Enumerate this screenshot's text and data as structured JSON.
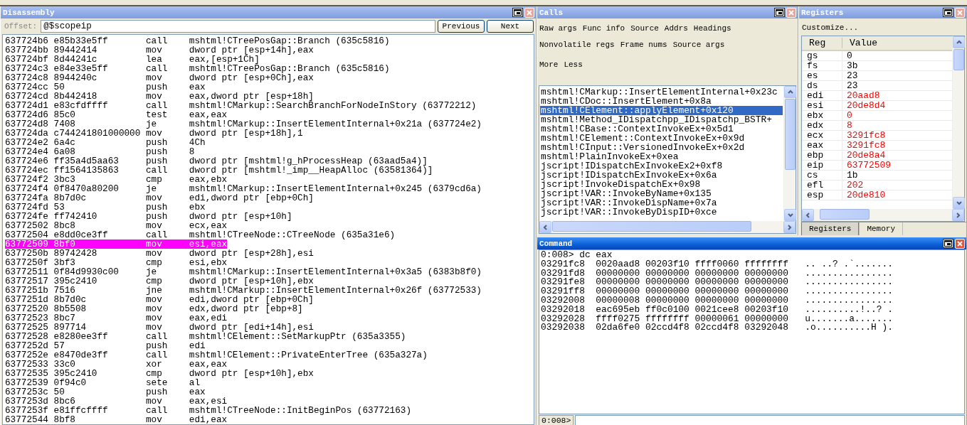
{
  "disassembly": {
    "title": "Disassembly",
    "active": false,
    "offset_label": "Offset:",
    "offset_value": "@$scopeip",
    "buttons": [
      "Previous",
      "Next"
    ],
    "rows": [
      {
        "address": "637724b6",
        "bytes": "e85b33e5ff",
        "mnemonic": "call",
        "operands": "mshtml!CTreePosGap::Branch (635c5816)",
        "selected": false
      },
      {
        "address": "637724bb",
        "bytes": "89442414",
        "mnemonic": "mov",
        "operands": "dword ptr [esp+14h],eax",
        "selected": false
      },
      {
        "address": "637724bf",
        "bytes": "8d44241c",
        "mnemonic": "lea",
        "operands": "eax,[esp+1Ch]",
        "selected": false
      },
      {
        "address": "637724c3",
        "bytes": "e84e33e5ff",
        "mnemonic": "call",
        "operands": "mshtml!CTreePosGap::Branch (635c5816)",
        "selected": false
      },
      {
        "address": "637724c8",
        "bytes": "8944240c",
        "mnemonic": "mov",
        "operands": "dword ptr [esp+0Ch],eax",
        "selected": false
      },
      {
        "address": "637724cc",
        "bytes": "50",
        "mnemonic": "push",
        "operands": "eax",
        "selected": false
      },
      {
        "address": "637724cd",
        "bytes": "8b442418",
        "mnemonic": "mov",
        "operands": "eax,dword ptr [esp+18h]",
        "selected": false
      },
      {
        "address": "637724d1",
        "bytes": "e83cfdffff",
        "mnemonic": "call",
        "operands": "mshtml!CMarkup::SearchBranchForNodeInStory (63772212)",
        "selected": false
      },
      {
        "address": "637724d6",
        "bytes": "85c0",
        "mnemonic": "test",
        "operands": "eax,eax",
        "selected": false
      },
      {
        "address": "637724d8",
        "bytes": "7408",
        "mnemonic": "je",
        "operands": "mshtml!CMarkup::InsertElementInternal+0x21a (637724e2)",
        "selected": false
      },
      {
        "address": "637724da",
        "bytes": "c744241801000000",
        "mnemonic": "mov",
        "operands": "dword ptr [esp+18h],1",
        "selected": false
      },
      {
        "address": "637724e2",
        "bytes": "6a4c",
        "mnemonic": "push",
        "operands": "4Ch",
        "selected": false
      },
      {
        "address": "637724e4",
        "bytes": "6a08",
        "mnemonic": "push",
        "operands": "8",
        "selected": false
      },
      {
        "address": "637724e6",
        "bytes": "ff35a4d5aa63",
        "mnemonic": "push",
        "operands": "dword ptr [mshtml!g_hProcessHeap (63aad5a4)]",
        "selected": false
      },
      {
        "address": "637724ec",
        "bytes": "ff1564135863",
        "mnemonic": "call",
        "operands": "dword ptr [mshtml!_imp__HeapAlloc (63581364)]",
        "selected": false
      },
      {
        "address": "637724f2",
        "bytes": "3bc3",
        "mnemonic": "cmp",
        "operands": "eax,ebx",
        "selected": false
      },
      {
        "address": "637724f4",
        "bytes": "0f8470a80200",
        "mnemonic": "je",
        "operands": "mshtml!CMarkup::InsertElementInternal+0x245 (6379cd6a)",
        "selected": false
      },
      {
        "address": "637724fa",
        "bytes": "8b7d0c",
        "mnemonic": "mov",
        "operands": "edi,dword ptr [ebp+0Ch]",
        "selected": false
      },
      {
        "address": "637724fd",
        "bytes": "53",
        "mnemonic": "push",
        "operands": "ebx",
        "selected": false
      },
      {
        "address": "637724fe",
        "bytes": "ff742410",
        "mnemonic": "push",
        "operands": "dword ptr [esp+10h]",
        "selected": false
      },
      {
        "address": "63772502",
        "bytes": "8bc8",
        "mnemonic": "mov",
        "operands": "ecx,eax",
        "selected": false
      },
      {
        "address": "63772504",
        "bytes": "e8dd0ce3ff",
        "mnemonic": "call",
        "operands": "mshtml!CTreeNode::CTreeNode (635a31e6)",
        "selected": false
      },
      {
        "address": "63772509",
        "bytes": "8bf0",
        "mnemonic": "mov",
        "operands": "esi,eax",
        "selected": true
      },
      {
        "address": "6377250b",
        "bytes": "89742428",
        "mnemonic": "mov",
        "operands": "dword ptr [esp+28h],esi",
        "selected": false
      },
      {
        "address": "6377250f",
        "bytes": "3bf3",
        "mnemonic": "cmp",
        "operands": "esi,ebx",
        "selected": false
      },
      {
        "address": "63772511",
        "bytes": "0f84d9930c00",
        "mnemonic": "je",
        "operands": "mshtml!CMarkup::InsertElementInternal+0x3a5 (6383b8f0)",
        "selected": false
      },
      {
        "address": "63772517",
        "bytes": "395c2410",
        "mnemonic": "cmp",
        "operands": "dword ptr [esp+10h],ebx",
        "selected": false
      },
      {
        "address": "6377251b",
        "bytes": "7516",
        "mnemonic": "jne",
        "operands": "mshtml!CMarkup::InsertElementInternal+0x26f (63772533)",
        "selected": false
      },
      {
        "address": "6377251d",
        "bytes": "8b7d0c",
        "mnemonic": "mov",
        "operands": "edi,dword ptr [ebp+0Ch]",
        "selected": false
      },
      {
        "address": "63772520",
        "bytes": "8b5508",
        "mnemonic": "mov",
        "operands": "edx,dword ptr [ebp+8]",
        "selected": false
      },
      {
        "address": "63772523",
        "bytes": "8bc7",
        "mnemonic": "mov",
        "operands": "eax,edi",
        "selected": false
      },
      {
        "address": "63772525",
        "bytes": "897714",
        "mnemonic": "mov",
        "operands": "dword ptr [edi+14h],esi",
        "selected": false
      },
      {
        "address": "63772528",
        "bytes": "e8280ee3ff",
        "mnemonic": "call",
        "operands": "mshtml!CElement::SetMarkupPtr (635a3355)",
        "selected": false
      },
      {
        "address": "6377252d",
        "bytes": "57",
        "mnemonic": "push",
        "operands": "edi",
        "selected": false
      },
      {
        "address": "6377252e",
        "bytes": "e8470de3ff",
        "mnemonic": "call",
        "operands": "mshtml!CElement::PrivateEnterTree (635a327a)",
        "selected": false
      },
      {
        "address": "63772533",
        "bytes": "33c0",
        "mnemonic": "xor",
        "operands": "eax,eax",
        "selected": false
      },
      {
        "address": "63772535",
        "bytes": "395c2410",
        "mnemonic": "cmp",
        "operands": "dword ptr [esp+10h],ebx",
        "selected": false
      },
      {
        "address": "63772539",
        "bytes": "0f94c0",
        "mnemonic": "sete",
        "operands": "al",
        "selected": false
      },
      {
        "address": "6377253c",
        "bytes": "50",
        "mnemonic": "push",
        "operands": "eax",
        "selected": false
      },
      {
        "address": "6377253d",
        "bytes": "8bc6",
        "mnemonic": "mov",
        "operands": "eax,esi",
        "selected": false
      },
      {
        "address": "6377253f",
        "bytes": "e81ffcffff",
        "mnemonic": "call",
        "operands": "mshtml!CTreeNode::InitBeginPos (63772163)",
        "selected": false
      },
      {
        "address": "63772544",
        "bytes": "8bf8",
        "mnemonic": "mov",
        "operands": "edi,eax",
        "selected": false
      }
    ]
  },
  "calls": {
    "title": "Calls",
    "active": false,
    "option_rows": [
      {
        "options": [
          "Raw args",
          "Func info",
          "Source",
          "Addrs",
          "Headings"
        ]
      },
      {
        "options": [
          "Nonvolatile regs",
          "Frame nums",
          "Source args"
        ]
      },
      {
        "options": [
          "More",
          "Less"
        ]
      }
    ],
    "frames": [
      {
        "text": "mshtml!CMarkup::InsertElementInternal+0x23c",
        "selected": false
      },
      {
        "text": "mshtml!CDoc::InsertElement+0x8a",
        "selected": false
      },
      {
        "text": "mshtml!CElement::applyElement+0x120",
        "selected": true
      },
      {
        "text": "mshtml!Method_IDispatchpp_IDispatchp_BSTR+",
        "selected": false
      },
      {
        "text": "mshtml!CBase::ContextInvokeEx+0x5d1",
        "selected": false
      },
      {
        "text": "mshtml!CElement::ContextInvokeEx+0x9d",
        "selected": false
      },
      {
        "text": "mshtml!CInput::VersionedInvokeEx+0x2d",
        "selected": false
      },
      {
        "text": "mshtml!PlainInvokeEx+0xea",
        "selected": false
      },
      {
        "text": "jscript!IDispatchExInvokeEx2+0xf8",
        "selected": false
      },
      {
        "text": "jscript!IDispatchExInvokeEx+0x6a",
        "selected": false
      },
      {
        "text": "jscript!InvokeDispatchEx+0x98",
        "selected": false
      },
      {
        "text": "jscript!VAR::InvokeByName+0x135",
        "selected": false
      },
      {
        "text": "jscript!VAR::InvokeDispName+0x7a",
        "selected": false
      },
      {
        "text": "jscript!VAR::InvokeByDispID+0xce",
        "selected": false
      }
    ]
  },
  "registers": {
    "title": "Registers",
    "active": false,
    "customize": "Customize...",
    "columns": [
      "Reg",
      "Value"
    ],
    "rows": [
      {
        "name": "gs",
        "value": "0",
        "changed": false
      },
      {
        "name": "fs",
        "value": "3b",
        "changed": false
      },
      {
        "name": "es",
        "value": "23",
        "changed": false
      },
      {
        "name": "ds",
        "value": "23",
        "changed": false
      },
      {
        "name": "edi",
        "value": "20aad8",
        "changed": true
      },
      {
        "name": "esi",
        "value": "20de8d4",
        "changed": true
      },
      {
        "name": "ebx",
        "value": "0",
        "changed": true
      },
      {
        "name": "edx",
        "value": "8",
        "changed": true
      },
      {
        "name": "ecx",
        "value": "3291fc8",
        "changed": true
      },
      {
        "name": "eax",
        "value": "3291fc8",
        "changed": true
      },
      {
        "name": "ebp",
        "value": "20de8a4",
        "changed": true
      },
      {
        "name": "eip",
        "value": "63772509",
        "changed": true
      },
      {
        "name": "cs",
        "value": "1b",
        "changed": false
      },
      {
        "name": "efl",
        "value": "202",
        "changed": true
      },
      {
        "name": "esp",
        "value": "20de810",
        "changed": true
      }
    ],
    "tabs": [
      {
        "label": "Registers",
        "selected": true
      },
      {
        "label": "Memory",
        "selected": false
      }
    ]
  },
  "command": {
    "title": "Command",
    "active": true,
    "command_line": "0:008> dc eax",
    "dump": [
      {
        "address": "03291fc8",
        "words": [
          "0020aad8",
          "00203f10",
          "ffff0060",
          "ffffffff"
        ],
        "ascii": ".. ..? .`......."
      },
      {
        "address": "03291fd8",
        "words": [
          "00000000",
          "00000000",
          "00000000",
          "00000000"
        ],
        "ascii": "................"
      },
      {
        "address": "03291fe8",
        "words": [
          "00000000",
          "00000000",
          "00000000",
          "00000000"
        ],
        "ascii": "................"
      },
      {
        "address": "03291ff8",
        "words": [
          "00000000",
          "00000000",
          "00000000",
          "00000000"
        ],
        "ascii": "................"
      },
      {
        "address": "03292008",
        "words": [
          "00000008",
          "00000000",
          "00000000",
          "00000000"
        ],
        "ascii": "................"
      },
      {
        "address": "03292018",
        "words": [
          "eac695eb",
          "ff0c0100",
          "0021cee8",
          "00203f10"
        ],
        "ascii": "..........!..? ."
      },
      {
        "address": "03292028",
        "words": [
          "ffff0275",
          "ffffffff",
          "00000061",
          "00000000"
        ],
        "ascii": "u.......a......."
      },
      {
        "address": "03292038",
        "words": [
          "02da6fe0",
          "02ccd4f8",
          "02ccd4f8",
          "03292048"
        ],
        "ascii": ".o..........H )."
      }
    ],
    "prompt": "0:008>"
  }
}
